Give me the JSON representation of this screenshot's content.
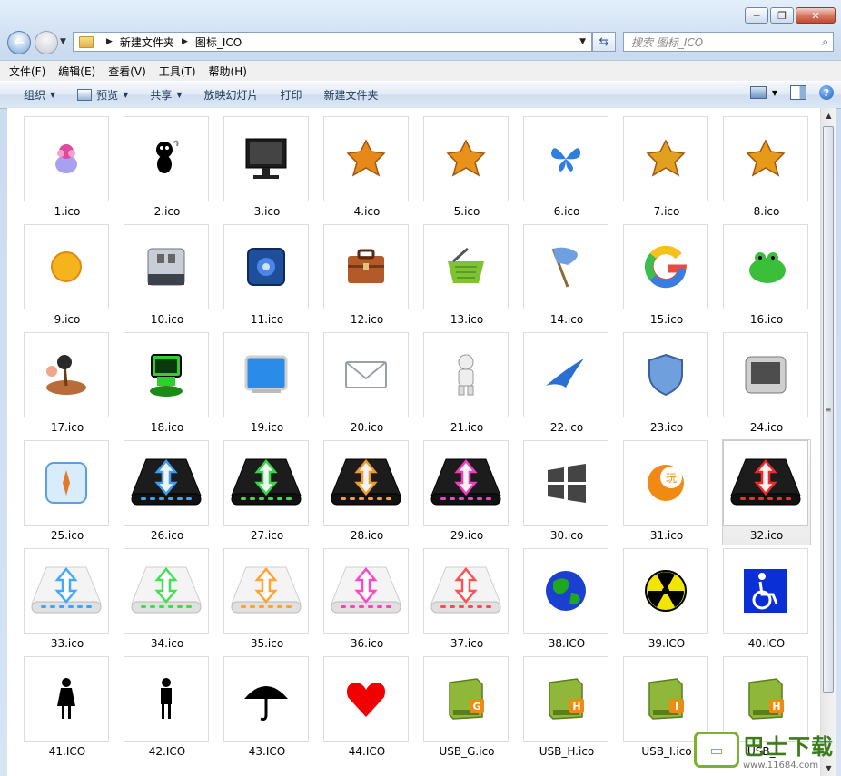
{
  "window": {
    "caption_buttons": [
      "─",
      "❐",
      "✕"
    ]
  },
  "address": {
    "path": [
      "新建文件夹",
      "图标_ICO"
    ],
    "search_placeholder": "搜索 图标_ICO"
  },
  "menu": [
    "文件(F)",
    "编辑(E)",
    "查看(V)",
    "工具(T)",
    "帮助(H)"
  ],
  "commands": [
    {
      "label": "组织",
      "dropdown": true
    },
    {
      "label": "预览",
      "dropdown": true,
      "icon": "preview-icon"
    },
    {
      "label": "共享",
      "dropdown": true
    },
    {
      "label": "放映幻灯片",
      "dropdown": false
    },
    {
      "label": "打印",
      "dropdown": false
    },
    {
      "label": "新建文件夹",
      "dropdown": false
    }
  ],
  "files": [
    {
      "name": "1.ico",
      "icon": "flower-cup-icon",
      "color": "#e04a9c"
    },
    {
      "name": "2.ico",
      "icon": "black-creature-icon",
      "color": "#111111"
    },
    {
      "name": "3.ico",
      "icon": "monitor-icon",
      "color": "#1b1b1b"
    },
    {
      "name": "4.ico",
      "icon": "orange-flower-icon",
      "color": "#e5891a"
    },
    {
      "name": "5.ico",
      "icon": "orange-leaf-icon",
      "color": "#e8921c"
    },
    {
      "name": "6.ico",
      "icon": "butterfly-icon",
      "color": "#2f7de1"
    },
    {
      "name": "7.ico",
      "icon": "bird-icon",
      "color": "#e0a020"
    },
    {
      "name": "8.ico",
      "icon": "maple-leaf-icon",
      "color": "#e69a1a"
    },
    {
      "name": "9.ico",
      "icon": "sun-icon",
      "color": "#f5b31d"
    },
    {
      "name": "10.ico",
      "icon": "usb-drive-icon",
      "color": "#707a86"
    },
    {
      "name": "11.ico",
      "icon": "blue-device-icon",
      "color": "#1f4f9c"
    },
    {
      "name": "12.ico",
      "icon": "briefcase-icon",
      "color": "#b25a2a"
    },
    {
      "name": "13.ico",
      "icon": "basket-icon",
      "color": "#7fc335"
    },
    {
      "name": "14.ico",
      "icon": "flag-icon",
      "color": "#6e9fe0"
    },
    {
      "name": "15.ico",
      "icon": "google-g-icon",
      "color": "#e94b3c"
    },
    {
      "name": "16.ico",
      "icon": "frog-icon",
      "color": "#3bbf3b"
    },
    {
      "name": "17.ico",
      "icon": "island-icon",
      "color": "#b86c3a"
    },
    {
      "name": "18.ico",
      "icon": "green-robot-icon",
      "color": "#2fcf2f"
    },
    {
      "name": "19.ico",
      "icon": "blue-screen-icon",
      "color": "#2a8be8"
    },
    {
      "name": "20.ico",
      "icon": "mail-icon",
      "color": "#9aa0a8"
    },
    {
      "name": "21.ico",
      "icon": "white-robot-icon",
      "color": "#c9c9c9"
    },
    {
      "name": "22.ico",
      "icon": "swoosh-icon",
      "color": "#2a6fd1"
    },
    {
      "name": "23.ico",
      "icon": "shield-icon",
      "color": "#6f9fdc"
    },
    {
      "name": "24.ico",
      "icon": "tablet-icon",
      "color": "#4d4d4d"
    },
    {
      "name": "25.ico",
      "icon": "compass-icon",
      "color": "#5aa0e0"
    },
    {
      "name": "26.ico",
      "icon": "upload-dock-blue-icon",
      "color": "#3aa6ff",
      "dark": true
    },
    {
      "name": "27.ico",
      "icon": "upload-dock-green-icon",
      "color": "#39e04a",
      "dark": true
    },
    {
      "name": "28.ico",
      "icon": "upload-dock-orange-icon",
      "color": "#ffa12a",
      "dark": true
    },
    {
      "name": "29.ico",
      "icon": "upload-dock-pink-icon",
      "color": "#ff3fc7",
      "dark": true
    },
    {
      "name": "30.ico",
      "icon": "windows-logo-icon",
      "color": "#444444"
    },
    {
      "name": "31.ico",
      "icon": "play-ball-icon",
      "color": "#f08a12"
    },
    {
      "name": "32.ico",
      "icon": "upload-dock-red-icon",
      "color": "#ff2a2a",
      "dark": true,
      "selected": true
    },
    {
      "name": "33.ico",
      "icon": "upload-dock-light-blue-icon",
      "color": "#3aa6ff",
      "dark": false
    },
    {
      "name": "34.ico",
      "icon": "upload-dock-light-green-icon",
      "color": "#39e04a",
      "dark": false
    },
    {
      "name": "35.ico",
      "icon": "upload-dock-light-orange-icon",
      "color": "#ffa12a",
      "dark": false
    },
    {
      "name": "36.ico",
      "icon": "upload-dock-light-pink-icon",
      "color": "#ff3fc7",
      "dark": false
    },
    {
      "name": "37.ico",
      "icon": "upload-dock-light-red-icon",
      "color": "#ff4a4a",
      "dark": false
    },
    {
      "name": "38.ICO",
      "icon": "globe-icon",
      "color": "#1a3fd1"
    },
    {
      "name": "39.ICO",
      "icon": "radiation-icon",
      "color": "#f2e600"
    },
    {
      "name": "40.ICO",
      "icon": "wheelchair-icon",
      "color": "#0a2fd6"
    },
    {
      "name": "41.ICO",
      "icon": "woman-icon",
      "color": "#000000"
    },
    {
      "name": "42.ICO",
      "icon": "man-icon",
      "color": "#000000"
    },
    {
      "name": "43.ICO",
      "icon": "umbrella-icon",
      "color": "#000000"
    },
    {
      "name": "44.ICO",
      "icon": "heart-icon",
      "color": "#f00000"
    },
    {
      "name": "USB_G.ico",
      "icon": "usb-drive-g-icon",
      "color": "#8fb83a",
      "letter": "G"
    },
    {
      "name": "USB_H.ico",
      "icon": "usb-drive-h-icon",
      "color": "#8fb83a",
      "letter": "H"
    },
    {
      "name": "USB_I.ico",
      "icon": "usb-drive-i-icon",
      "color": "#8fb83a",
      "letter": "I"
    },
    {
      "name": "USB_...",
      "icon": "usb-drive-h2-icon",
      "color": "#8fb83a",
      "letter": "H"
    }
  ],
  "watermark": {
    "cn": "巴士下载",
    "url": "www.11684.com"
  }
}
